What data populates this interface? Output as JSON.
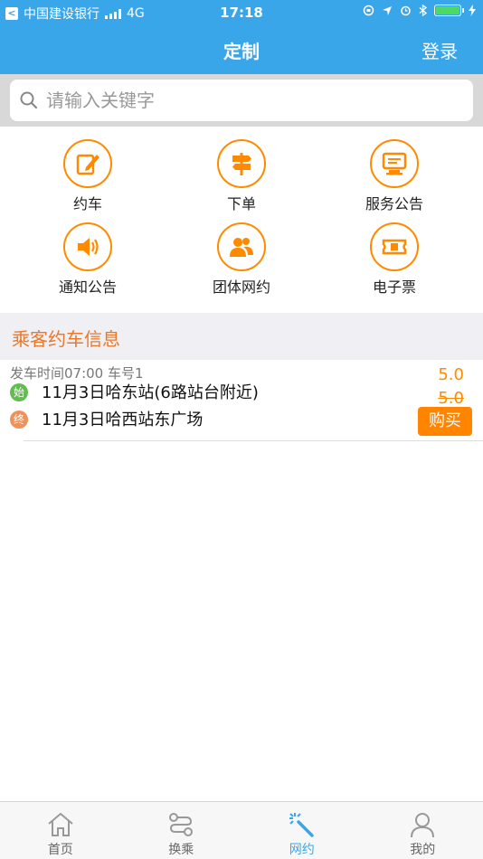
{
  "status_bar": {
    "carrier": "中国建设银行",
    "network": "4G",
    "time": "17:18"
  },
  "navbar": {
    "title": "定制",
    "login": "登录"
  },
  "search": {
    "placeholder": "请输入关键字"
  },
  "menu": {
    "items": [
      {
        "label": "约车",
        "icon": "edit-icon"
      },
      {
        "label": "下单",
        "icon": "signpost-icon"
      },
      {
        "label": "服务公告",
        "icon": "notice-board-icon"
      },
      {
        "label": "通知公告",
        "icon": "speaker-icon"
      },
      {
        "label": "团体网约",
        "icon": "group-icon"
      },
      {
        "label": "电子票",
        "icon": "ticket-icon"
      }
    ]
  },
  "section": {
    "title": "乘客约车信息"
  },
  "trip": {
    "meta": "发车时间07:00  车号1",
    "start_badge": "始",
    "end_badge": "终",
    "from": "11月3日哈东站(6路站台附近)",
    "to": "11月3日哈西站东广场",
    "price": "5.0",
    "original_price": "5.0",
    "buy_label": "购买"
  },
  "tabbar": {
    "items": [
      {
        "label": "首页",
        "icon": "home-icon"
      },
      {
        "label": "换乘",
        "icon": "route-icon"
      },
      {
        "label": "网约",
        "icon": "magic-wand-icon"
      },
      {
        "label": "我的",
        "icon": "user-icon"
      }
    ],
    "active": "网约"
  },
  "colors": {
    "primary": "#3aa6ea",
    "accent": "#ff8a00",
    "section_title": "#e8782a"
  }
}
